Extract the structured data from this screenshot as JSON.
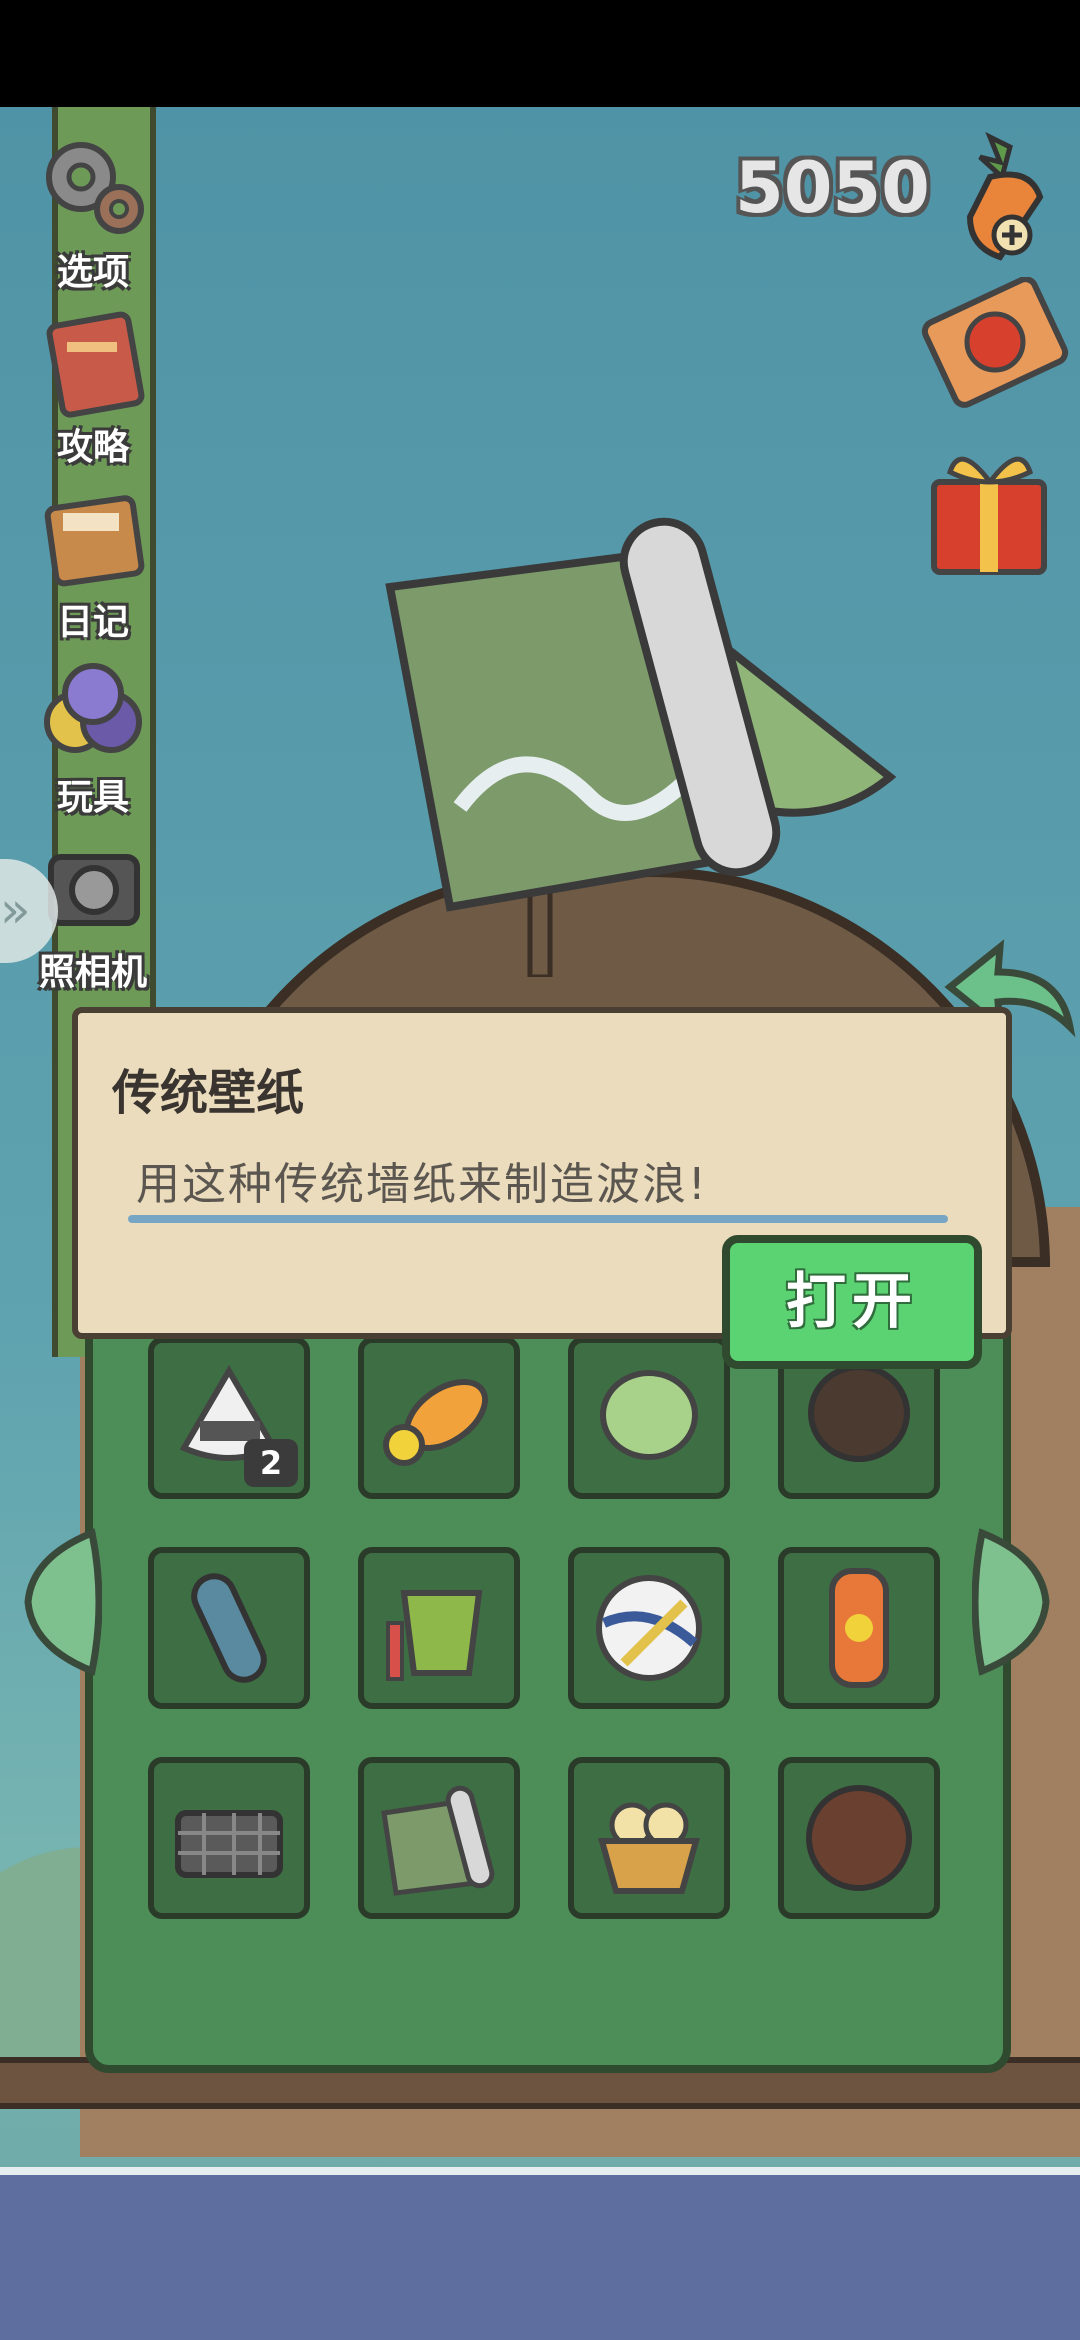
{
  "hud": {
    "carrot_count": "5050"
  },
  "menu": [
    {
      "label": "选项",
      "icon": "gear-icon"
    },
    {
      "label": "攻略",
      "icon": "guide-book-icon"
    },
    {
      "label": "日记",
      "icon": "diary-icon"
    },
    {
      "label": "玩具",
      "icon": "toys-icon"
    },
    {
      "label": "照相机",
      "icon": "camera-icon"
    }
  ],
  "dialog": {
    "title": "传统壁纸",
    "description": "用这种传统墙纸来制造波浪!",
    "open_label": "打开"
  },
  "inventory": {
    "items": [
      {
        "name": "onigiri",
        "count": "2"
      },
      {
        "name": "duck-float"
      },
      {
        "name": "melon-bread"
      },
      {
        "name": "coconut-husk"
      },
      {
        "name": "yoga-mat"
      },
      {
        "name": "sand-bucket"
      },
      {
        "name": "volleyball"
      },
      {
        "name": "sunscreen"
      },
      {
        "name": "charcoal"
      },
      {
        "name": "traditional-wallpaper"
      },
      {
        "name": "ice-cream-basket"
      },
      {
        "name": "coconut"
      }
    ]
  },
  "colors": {
    "panel": "#4d8d58",
    "button": "#5bd372",
    "dialog": "#eadcbc"
  }
}
